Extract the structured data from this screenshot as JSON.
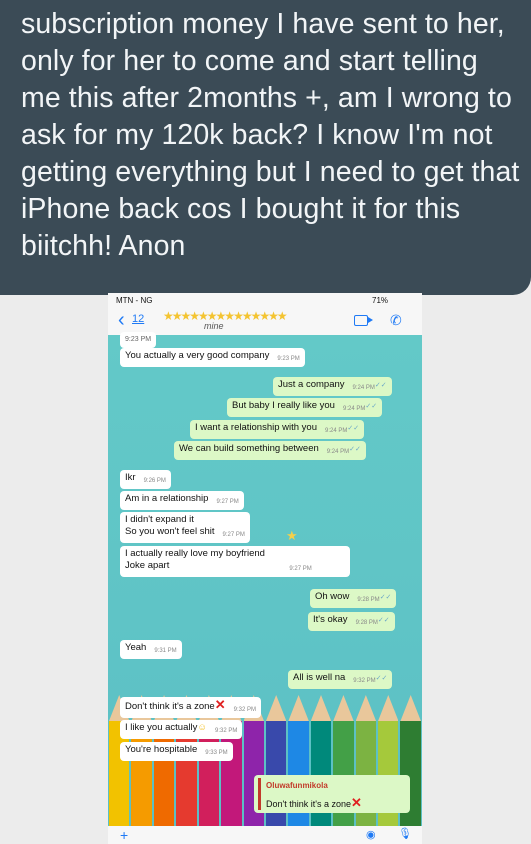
{
  "caption": {
    "text": "subscription money I have sent to her, only for her to come and start telling me this after 2months +, am I wrong to ask for my 120k back? I know I'm not getting everything but I need to get that iPhone back cos I bought it for this biitchh! Anon"
  },
  "statusbar": {
    "carrier": "MTN - NG",
    "battery": "71%"
  },
  "header": {
    "back_count": "12",
    "contact_fragment": "mine",
    "prev_time": "9:23 PM"
  },
  "messages": [
    {
      "text": "You actually a very good company",
      "time": "9:23 PM",
      "side": "in"
    },
    {
      "text": "Just a company",
      "time": "9:24 PM",
      "side": "out"
    },
    {
      "text": "But baby I really like you",
      "time": "9:24 PM",
      "side": "out"
    },
    {
      "text": "I want a relationship with you",
      "time": "9:24 PM",
      "side": "out"
    },
    {
      "text": "We can build something between",
      "time": "9:24 PM",
      "side": "out"
    },
    {
      "text": "Ikr",
      "time": "9:26 PM",
      "side": "in"
    },
    {
      "text": "Am in a relationship",
      "time": "9:27 PM",
      "side": "in"
    },
    {
      "text": "I didn't expand it",
      "line2": "So you won't feel shit",
      "time": "9:27 PM",
      "side": "in"
    },
    {
      "text": "I actually really love my boyfriend",
      "line2": "Joke apart",
      "time": "9:27 PM",
      "side": "in"
    },
    {
      "text": "Oh wow",
      "time": "9:28 PM",
      "side": "out"
    },
    {
      "text": "It's okay",
      "time": "9:28 PM",
      "side": "out"
    },
    {
      "text": "Yeah",
      "time": "9:31 PM",
      "side": "in"
    },
    {
      "text": "All is well na",
      "time": "9:32 PM",
      "side": "out"
    },
    {
      "text": "Don't think it's a zone",
      "time": "9:32 PM",
      "side": "in"
    },
    {
      "text": "I like you actually",
      "time": "9:32 PM",
      "side": "in"
    },
    {
      "text": "You're hospitable",
      "time": "9:33 PM",
      "side": "in"
    }
  ],
  "quote": {
    "name": "Oluwafunmikola",
    "text": "Don't think it's a zone"
  },
  "colors": {
    "caption_bg": "#3b4b56",
    "chat_bg": "#5fc4c6",
    "outgoing": "#dcf8c6",
    "accent": "#1f7af5"
  }
}
